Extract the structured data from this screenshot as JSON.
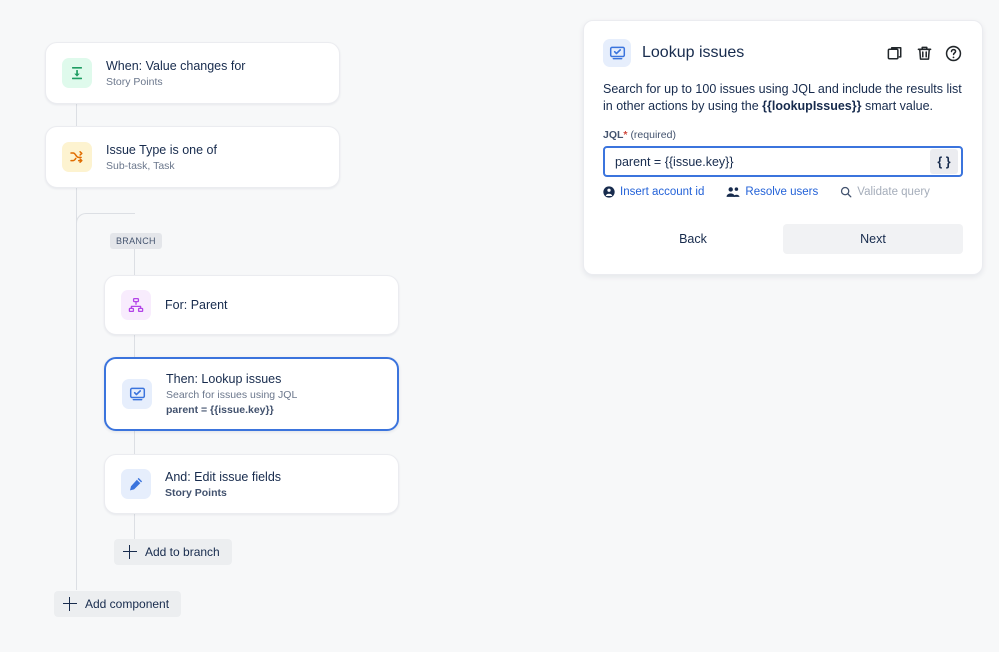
{
  "canvas": {
    "branch_label": "BRANCH",
    "nodes": [
      {
        "id": "trigger",
        "title": "When: Value changes for",
        "subtitle": "Story Points",
        "icon": "value-changes-icon",
        "icon_color": "green"
      },
      {
        "id": "condition",
        "title": "Issue Type is one of",
        "subtitle": "Sub-task, Task",
        "icon": "shuffle-icon",
        "icon_color": "yellow"
      },
      {
        "id": "branch-for-parent",
        "title": "For: Parent",
        "subtitle": "",
        "icon": "hierarchy-icon",
        "icon_color": "purple"
      },
      {
        "id": "lookup-issues",
        "title": "Then: Lookup issues",
        "subtitle": "Search for issues using JQL",
        "subtitle2": "parent = {{issue.key}}",
        "icon": "lookup-issues-icon",
        "icon_color": "blue",
        "selected": true
      },
      {
        "id": "edit-issue-fields",
        "title": "And: Edit issue fields",
        "subtitle": "Story Points",
        "icon": "pencil-icon",
        "icon_color": "blue"
      }
    ],
    "add_to_branch_label": "Add to branch",
    "add_component_label": "Add component"
  },
  "panel": {
    "title": "Lookup issues",
    "icon": "lookup-issues-icon",
    "actions": [
      {
        "name": "duplicate-icon",
        "label": "Duplicate"
      },
      {
        "name": "trash-icon",
        "label": "Delete"
      },
      {
        "name": "help-icon",
        "label": "Help"
      }
    ],
    "description_part1": "Search for up to 100 issues using JQL and include the results list in other actions by using the ",
    "description_smart_value": "{{lookupIssues}}",
    "description_part2": " smart value.",
    "field": {
      "label": "JQL",
      "required_star": "*",
      "required_text": "(required)",
      "value": "parent = {{issue.key}}",
      "placeholder": "",
      "smart_value_button": "{ }"
    },
    "helpers": [
      {
        "name": "insert-account-id",
        "label": "Insert account id",
        "icon": "person-icon",
        "disabled": false
      },
      {
        "name": "resolve-users",
        "label": "Resolve users",
        "icon": "people-icon",
        "disabled": false
      },
      {
        "name": "validate-query",
        "label": "Validate query",
        "icon": "search-icon",
        "disabled": true
      }
    ],
    "back_label": "Back",
    "next_label": "Next"
  },
  "colors": {
    "page_background": "#f7f8f9",
    "accent_blue": "#3b74dd",
    "link_blue": "#2362d8",
    "disabled_gray": "#a5adba"
  }
}
